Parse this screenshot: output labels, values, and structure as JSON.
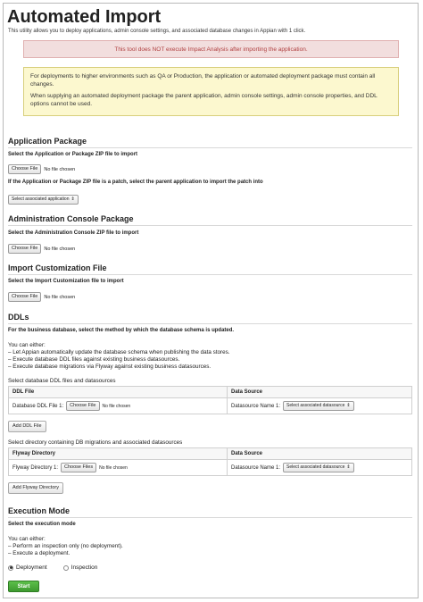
{
  "header": {
    "title": "Automated Import",
    "subtitle": "This utility allows you to deploy applications, admin console settings, and associated database changes in Appian with 1 click."
  },
  "alerts": {
    "error": "This tool does NOT execute Impact Analysis after importing the application.",
    "info_1": "For deployments to higher environments such as QA or Production, the application or automated deployment package must contain all changes.",
    "info_2": "When supplying an automated deployment package the parent application, admin console settings, admin console properties, and DDL options cannot be used."
  },
  "application_package": {
    "title": "Application Package",
    "zip_label": "Select the Application or Package ZIP file to import",
    "choose_file": "Choose File",
    "no_file": "No file chosen",
    "patch_label": "If the Application or Package ZIP file is a patch, select the parent application to import the patch into",
    "parent_select": "Select associated application"
  },
  "admin_console": {
    "title": "Administration Console Package",
    "zip_label": "Select the Administration Console ZIP file to import",
    "choose_file": "Choose File",
    "no_file": "No file chosen"
  },
  "customization": {
    "title": "Import Customization File",
    "label": "Select the Import Customization file to import",
    "choose_file": "Choose File",
    "no_file": "No file chosen"
  },
  "ddls": {
    "title": "DDLs",
    "method_label": "For the business database, select the method by which the database schema is updated.",
    "either": "You can either:",
    "option_1": "– Let Appian automatically update the database schema when publishing the data stores.",
    "option_2": "– Execute database DDL files against existing business datasources.",
    "option_3": "– Execute database migrations via Flyway against existing business datasources.",
    "ddl_section_label": "Select database DDL files and datasources",
    "ddl_table": {
      "col_1": "DDL File",
      "col_2": "Data Source",
      "row_label": "Database DDL File 1:",
      "choose_file": "Choose File",
      "no_file": "No file chosen",
      "ds_label": "Datasource Name 1:",
      "ds_select": "Select associated datasource"
    },
    "add_ddl": "Add DDL File",
    "flyway_section_label": "Select directory containing DB migrations and associated datasources",
    "flyway_table": {
      "col_1": "Flyway Directory",
      "col_2": "Data Source",
      "row_label": "Flyway Directory 1:",
      "choose_file": "Choose Files",
      "no_file": "No file chosen",
      "ds_label": "Datasource Name 1:",
      "ds_select": "Select associated datasource"
    },
    "add_flyway": "Add Flyway Directory"
  },
  "execution": {
    "title": "Execution Mode",
    "label": "Select the execution mode",
    "either": "You can either:",
    "option_1": "– Perform an inspection only (no deployment).",
    "option_2": "– Execute a deployment.",
    "radio_deployment": "Deployment",
    "radio_inspection": "Inspection",
    "selected": "Deployment",
    "start": "Start"
  },
  "colors": {
    "start_button": "#4aab3a",
    "error_bg": "#f2dede",
    "info_bg": "#fcf8cf"
  }
}
